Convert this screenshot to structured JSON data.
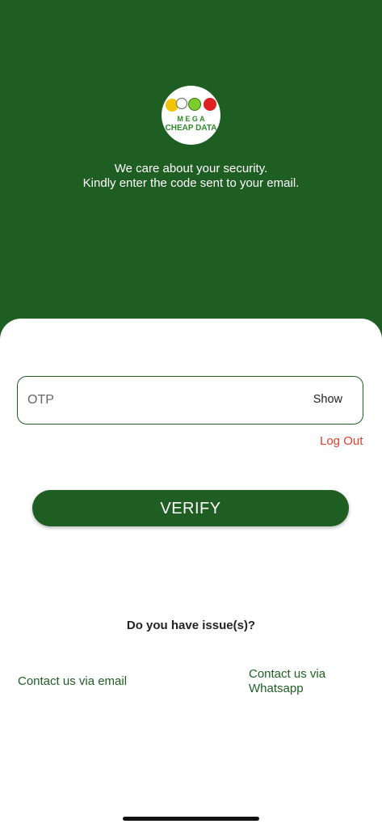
{
  "colors": {
    "brand_green": "#1f5e22",
    "logout_red": "#e0402c",
    "background": "#ffffff"
  },
  "logo": {
    "icon": "mega-cheap-data-logo",
    "text_top": "M E G A",
    "text_bottom": "CHEAP DATA"
  },
  "header": {
    "line1": "We care about your security.",
    "line2": "Kindly enter the code sent to your email."
  },
  "otp": {
    "placeholder": "OTP",
    "value": "",
    "toggle_label": "Show"
  },
  "logout_label": "Log Out",
  "verify_label": "VERIFY",
  "issues_label": "Do you have issue(s)?",
  "contact": {
    "email_label": "Contact us via email",
    "whatsapp_line1": "Contact us via",
    "whatsapp_line2": "Whatsapp"
  }
}
